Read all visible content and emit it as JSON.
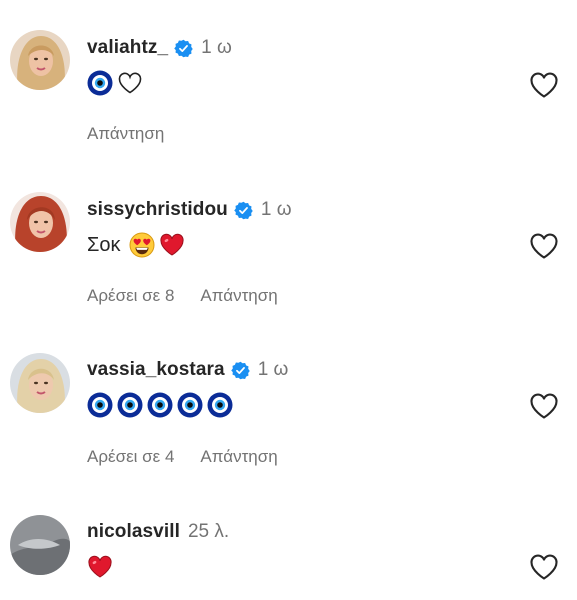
{
  "comments": [
    {
      "username": "valiahtz_",
      "verified": true,
      "time": "1 ω",
      "text": "",
      "emojis": [
        "nazar-icon",
        "white-heart-icon"
      ],
      "likes_label": "",
      "reply_label": "Απάντηση"
    },
    {
      "username": "sissychristidou",
      "verified": true,
      "time": "1 ω",
      "text": "Σοκ",
      "emojis": [
        "heart-eyes-icon",
        "red-heart-icon"
      ],
      "likes_label": "Αρέσει σε 8",
      "reply_label": "Απάντηση"
    },
    {
      "username": "vassia_kostara",
      "verified": true,
      "time": "1 ω",
      "text": "",
      "emojis": [
        "nazar-icon",
        "nazar-icon",
        "nazar-icon",
        "nazar-icon",
        "nazar-icon"
      ],
      "likes_label": "Αρέσει σε 4",
      "reply_label": "Απάντηση"
    },
    {
      "username": "nicolasvill",
      "verified": false,
      "time": "25 λ.",
      "text": "",
      "emojis": [
        "red-heart-icon"
      ],
      "likes_label": "",
      "reply_label": ""
    }
  ],
  "colors": {
    "username": "#262626",
    "meta": "#737373",
    "verified": "#1a8ff2",
    "heart_red": "#e0182d"
  }
}
